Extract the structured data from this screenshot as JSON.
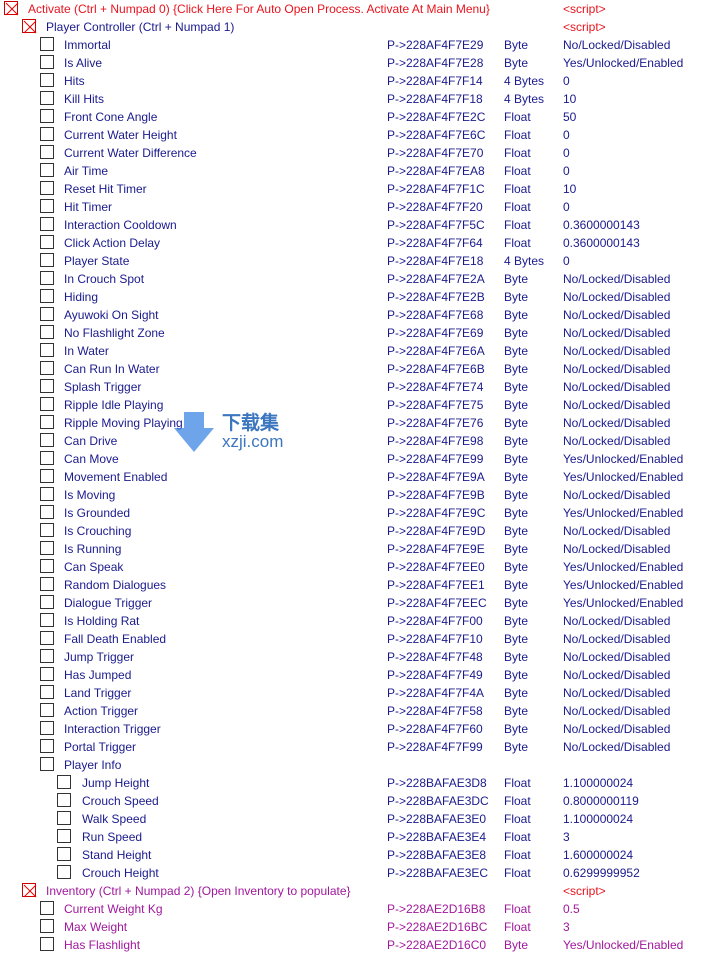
{
  "colors": {
    "activate": "#e8141e",
    "player": "#1a1a8c",
    "inventory": "#a0189c"
  },
  "rows": [
    {
      "level": 0,
      "checked": true,
      "group": "activate",
      "desc": "Activate (Ctrl + Numpad 0) {Click Here For Auto Open Process. Activate At Main Menu}",
      "addr": "",
      "type": "",
      "val": "<script>"
    },
    {
      "level": 1,
      "checked": true,
      "group": "player",
      "desc": "Player Controller (Ctrl + Numpad 1)",
      "addr": "",
      "type": "",
      "val": "<script>"
    },
    {
      "level": 2,
      "group": "player",
      "desc": "Immortal",
      "addr": "P->228AF4F7E29",
      "type": "Byte",
      "val": "No/Locked/Disabled"
    },
    {
      "level": 2,
      "group": "player",
      "desc": "Is Alive",
      "addr": "P->228AF4F7E28",
      "type": "Byte",
      "val": "Yes/Unlocked/Enabled"
    },
    {
      "level": 2,
      "group": "player",
      "desc": "Hits",
      "addr": "P->228AF4F7F14",
      "type": "4 Bytes",
      "val": "0"
    },
    {
      "level": 2,
      "group": "player",
      "desc": "Kill Hits",
      "addr": "P->228AF4F7F18",
      "type": "4 Bytes",
      "val": "10"
    },
    {
      "level": 2,
      "group": "player",
      "desc": "Front Cone Angle",
      "addr": "P->228AF4F7E2C",
      "type": "Float",
      "val": "50"
    },
    {
      "level": 2,
      "group": "player",
      "desc": "Current Water Height",
      "addr": "P->228AF4F7E6C",
      "type": "Float",
      "val": "0"
    },
    {
      "level": 2,
      "group": "player",
      "desc": "Current Water Difference",
      "addr": "P->228AF4F7E70",
      "type": "Float",
      "val": "0"
    },
    {
      "level": 2,
      "group": "player",
      "desc": "Air Time",
      "addr": "P->228AF4F7EA8",
      "type": "Float",
      "val": "0"
    },
    {
      "level": 2,
      "group": "player",
      "desc": "Reset Hit Timer",
      "addr": "P->228AF4F7F1C",
      "type": "Float",
      "val": "10"
    },
    {
      "level": 2,
      "group": "player",
      "desc": "Hit Timer",
      "addr": "P->228AF4F7F20",
      "type": "Float",
      "val": "0"
    },
    {
      "level": 2,
      "group": "player",
      "desc": "Interaction Cooldown",
      "addr": "P->228AF4F7F5C",
      "type": "Float",
      "val": "0.3600000143"
    },
    {
      "level": 2,
      "group": "player",
      "desc": "Click Action Delay",
      "addr": "P->228AF4F7F64",
      "type": "Float",
      "val": "0.3600000143"
    },
    {
      "level": 2,
      "group": "player",
      "desc": "Player State",
      "addr": "P->228AF4F7E18",
      "type": "4 Bytes",
      "val": "0"
    },
    {
      "level": 2,
      "group": "player",
      "desc": "In Crouch Spot",
      "addr": "P->228AF4F7E2A",
      "type": "Byte",
      "val": "No/Locked/Disabled"
    },
    {
      "level": 2,
      "group": "player",
      "desc": "Hiding",
      "addr": "P->228AF4F7E2B",
      "type": "Byte",
      "val": "No/Locked/Disabled"
    },
    {
      "level": 2,
      "group": "player",
      "desc": "Ayuwoki On Sight",
      "addr": "P->228AF4F7E68",
      "type": "Byte",
      "val": "No/Locked/Disabled"
    },
    {
      "level": 2,
      "group": "player",
      "desc": "No Flashlight Zone",
      "addr": "P->228AF4F7E69",
      "type": "Byte",
      "val": "No/Locked/Disabled"
    },
    {
      "level": 2,
      "group": "player",
      "desc": "In Water",
      "addr": "P->228AF4F7E6A",
      "type": "Byte",
      "val": "No/Locked/Disabled"
    },
    {
      "level": 2,
      "group": "player",
      "desc": "Can Run In Water",
      "addr": "P->228AF4F7E6B",
      "type": "Byte",
      "val": "No/Locked/Disabled"
    },
    {
      "level": 2,
      "group": "player",
      "desc": "Splash Trigger",
      "addr": "P->228AF4F7E74",
      "type": "Byte",
      "val": "No/Locked/Disabled"
    },
    {
      "level": 2,
      "group": "player",
      "desc": "Ripple Idle Playing",
      "addr": "P->228AF4F7E75",
      "type": "Byte",
      "val": "No/Locked/Disabled"
    },
    {
      "level": 2,
      "group": "player",
      "desc": "Ripple Moving Playing",
      "addr": "P->228AF4F7E76",
      "type": "Byte",
      "val": "No/Locked/Disabled"
    },
    {
      "level": 2,
      "group": "player",
      "desc": "Can Drive",
      "addr": "P->228AF4F7E98",
      "type": "Byte",
      "val": "No/Locked/Disabled"
    },
    {
      "level": 2,
      "group": "player",
      "desc": "Can Move",
      "addr": "P->228AF4F7E99",
      "type": "Byte",
      "val": "Yes/Unlocked/Enabled"
    },
    {
      "level": 2,
      "group": "player",
      "desc": "Movement Enabled",
      "addr": "P->228AF4F7E9A",
      "type": "Byte",
      "val": "Yes/Unlocked/Enabled"
    },
    {
      "level": 2,
      "group": "player",
      "desc": "Is Moving",
      "addr": "P->228AF4F7E9B",
      "type": "Byte",
      "val": "No/Locked/Disabled"
    },
    {
      "level": 2,
      "group": "player",
      "desc": "Is Grounded",
      "addr": "P->228AF4F7E9C",
      "type": "Byte",
      "val": "Yes/Unlocked/Enabled"
    },
    {
      "level": 2,
      "group": "player",
      "desc": "Is Crouching",
      "addr": "P->228AF4F7E9D",
      "type": "Byte",
      "val": "No/Locked/Disabled"
    },
    {
      "level": 2,
      "group": "player",
      "desc": "Is Running",
      "addr": "P->228AF4F7E9E",
      "type": "Byte",
      "val": "No/Locked/Disabled"
    },
    {
      "level": 2,
      "group": "player",
      "desc": "Can Speak",
      "addr": "P->228AF4F7EE0",
      "type": "Byte",
      "val": "Yes/Unlocked/Enabled"
    },
    {
      "level": 2,
      "group": "player",
      "desc": "Random Dialogues",
      "addr": "P->228AF4F7EE1",
      "type": "Byte",
      "val": "Yes/Unlocked/Enabled"
    },
    {
      "level": 2,
      "group": "player",
      "desc": "Dialogue Trigger",
      "addr": "P->228AF4F7EEC",
      "type": "Byte",
      "val": "Yes/Unlocked/Enabled"
    },
    {
      "level": 2,
      "group": "player",
      "desc": "Is Holding Rat",
      "addr": "P->228AF4F7F00",
      "type": "Byte",
      "val": "No/Locked/Disabled"
    },
    {
      "level": 2,
      "group": "player",
      "desc": "Fall Death Enabled",
      "addr": "P->228AF4F7F10",
      "type": "Byte",
      "val": "No/Locked/Disabled"
    },
    {
      "level": 2,
      "group": "player",
      "desc": "Jump Trigger",
      "addr": "P->228AF4F7F48",
      "type": "Byte",
      "val": "No/Locked/Disabled"
    },
    {
      "level": 2,
      "group": "player",
      "desc": "Has Jumped",
      "addr": "P->228AF4F7F49",
      "type": "Byte",
      "val": "No/Locked/Disabled"
    },
    {
      "level": 2,
      "group": "player",
      "desc": "Land Trigger",
      "addr": "P->228AF4F7F4A",
      "type": "Byte",
      "val": "No/Locked/Disabled"
    },
    {
      "level": 2,
      "group": "player",
      "desc": "Action Trigger",
      "addr": "P->228AF4F7F58",
      "type": "Byte",
      "val": "No/Locked/Disabled"
    },
    {
      "level": 2,
      "group": "player",
      "desc": "Interaction Trigger",
      "addr": "P->228AF4F7F60",
      "type": "Byte",
      "val": "No/Locked/Disabled"
    },
    {
      "level": 2,
      "group": "player",
      "desc": "Portal Trigger",
      "addr": "P->228AF4F7F99",
      "type": "Byte",
      "val": "No/Locked/Disabled"
    },
    {
      "level": 2,
      "group": "player",
      "desc": "Player Info",
      "addr": "",
      "type": "",
      "val": ""
    },
    {
      "level": 3,
      "group": "player",
      "desc": "Jump Height",
      "addr": "P->228BAFAE3D8",
      "type": "Float",
      "val": "1.100000024"
    },
    {
      "level": 3,
      "group": "player",
      "desc": "Crouch Speed",
      "addr": "P->228BAFAE3DC",
      "type": "Float",
      "val": "0.8000000119"
    },
    {
      "level": 3,
      "group": "player",
      "desc": "Walk Speed",
      "addr": "P->228BAFAE3E0",
      "type": "Float",
      "val": "1.100000024"
    },
    {
      "level": 3,
      "group": "player",
      "desc": "Run Speed",
      "addr": "P->228BAFAE3E4",
      "type": "Float",
      "val": "3"
    },
    {
      "level": 3,
      "group": "player",
      "desc": "Stand Height",
      "addr": "P->228BAFAE3E8",
      "type": "Float",
      "val": "1.600000024"
    },
    {
      "level": 3,
      "group": "player",
      "desc": "Crouch Height",
      "addr": "P->228BAFAE3EC",
      "type": "Float",
      "val": "0.6299999952"
    },
    {
      "level": 1,
      "checked": true,
      "group": "inventory",
      "desc": "Inventory (Ctrl + Numpad 2) {Open Inventory to populate}",
      "addr": "",
      "type": "",
      "val": "<script>"
    },
    {
      "level": 2,
      "group": "inventory",
      "desc": "Current Weight Kg",
      "addr": "P->228AE2D16B8",
      "type": "Float",
      "val": "0.5"
    },
    {
      "level": 2,
      "group": "inventory",
      "desc": "Max Weight",
      "addr": "P->228AE2D16BC",
      "type": "Float",
      "val": "3"
    },
    {
      "level": 2,
      "group": "inventory",
      "desc": "Has Flashlight",
      "addr": "P->228AE2D16C0",
      "type": "Byte",
      "val": "Yes/Unlocked/Enabled"
    }
  ],
  "watermark": {
    "title": "下载集",
    "site": "xzji.com"
  }
}
